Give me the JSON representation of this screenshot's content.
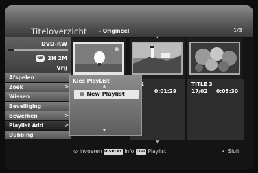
{
  "header": {
    "title": "Titeloverzicht",
    "subtitle": "- Origineel",
    "page": "1/3"
  },
  "disc": {
    "type": "DVD-RW",
    "mode": "SP",
    "time": "2H 2M",
    "free_label": "Vrij",
    "usage_fraction": 0.1
  },
  "menu": {
    "items": [
      {
        "label": "Afspelen",
        "arrow": ""
      },
      {
        "label": "Zoek",
        "arrow": ">"
      },
      {
        "label": "Wissen",
        "arrow": ""
      },
      {
        "label": "Beveiliging",
        "arrow": ""
      },
      {
        "label": "Bewerken",
        "arrow": ">"
      },
      {
        "label": "Playlist Add",
        "arrow": ">"
      },
      {
        "label": "Dubbing",
        "arrow": ""
      }
    ],
    "active_index": 5
  },
  "titles": [
    {
      "name": "",
      "date": "",
      "duration": ""
    },
    {
      "name": "E 2",
      "date": "02",
      "duration": "0:01:29"
    },
    {
      "name": "TITLE 3",
      "date": "17/02",
      "duration": "0:05:30"
    }
  ],
  "popup": {
    "title": "Kies PlayList",
    "option": "New Playlist"
  },
  "footer": {
    "enter": "Invoeren",
    "display_key": "DISPLAY",
    "info": "Info",
    "list_key": "LIST",
    "playlist": "Playlist",
    "close": "Sluit"
  }
}
